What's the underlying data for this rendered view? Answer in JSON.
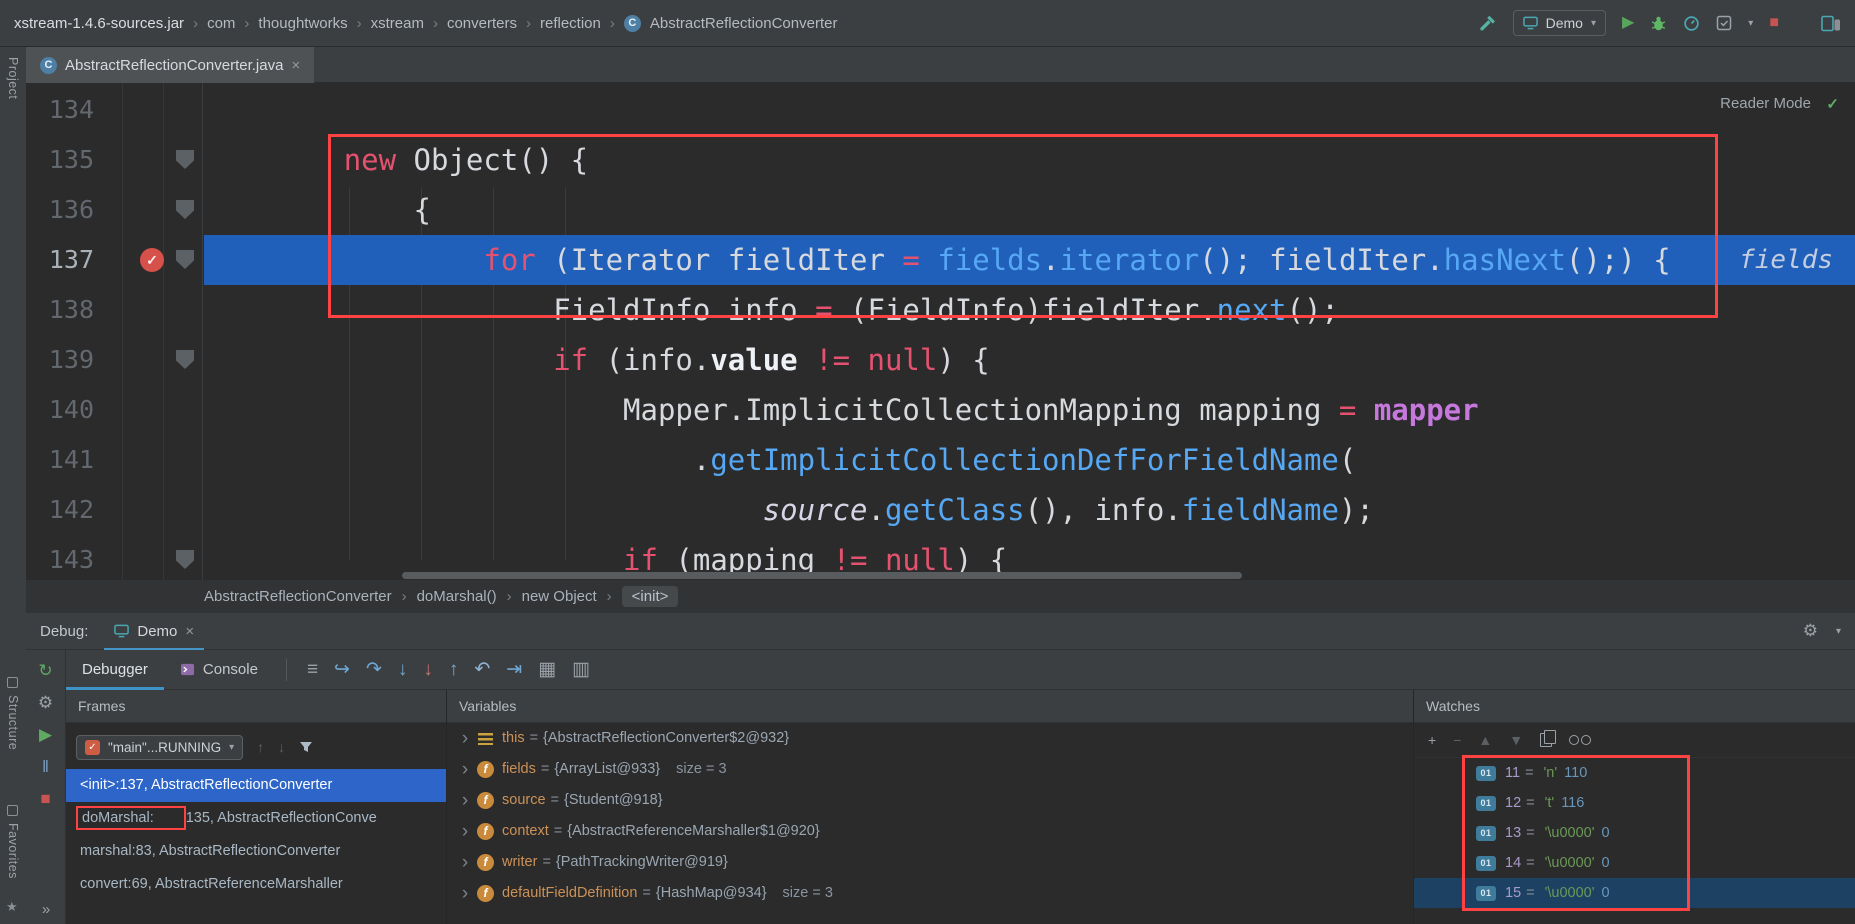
{
  "icons": {
    "class_glyph": "C",
    "check_glyph": "✓",
    "close_glyph": "×",
    "combo_arrow_glyph": "▾",
    "separator_glyph": "›",
    "primitive_glyph": "01",
    "field_glyph": "f",
    "gear_glyph": "⚙",
    "star_glyph": "★",
    "run_glyph": "▶",
    "stop_glyph": "■",
    "up_glyph": "↑",
    "down_glyph": "↓",
    "more_glyph": "»"
  },
  "topbar": {
    "path": [
      "xstream-1.4.6-sources.jar",
      "com",
      "thoughtworks",
      "xstream",
      "converters",
      "reflection"
    ],
    "class_name": "AbstractReflectionConverter",
    "run_config": "Demo"
  },
  "stripes": {
    "project": "Project",
    "structure": "Structure",
    "favorites": "Favorites"
  },
  "editor": {
    "tab": "AbstractReflectionConverter.java",
    "reader_mode": "Reader Mode",
    "inline_hint": "fields",
    "breadcrumbs": [
      "AbstractReflectionConverter",
      "doMarshal()",
      "new Object",
      "<init>"
    ],
    "lines": [
      {
        "num": "134",
        "gutter": "",
        "tokens": []
      },
      {
        "num": "135",
        "gutter": "pent",
        "tokens": [
          [
            "        ",
            "pl"
          ],
          [
            "new",
            "kw"
          ],
          [
            " Object() {",
            "pl"
          ]
        ]
      },
      {
        "num": "136",
        "gutter": "pent",
        "tokens": [
          [
            "            {",
            "pl"
          ]
        ]
      },
      {
        "num": "137",
        "gutter": "bp",
        "current": true,
        "tokens": [
          [
            "                ",
            "pl"
          ],
          [
            "for",
            "kw"
          ],
          [
            " (Iterator fieldIter ",
            "pl"
          ],
          [
            "=",
            "kw"
          ],
          [
            " ",
            "pl"
          ],
          [
            "fields",
            "fld"
          ],
          [
            ".",
            "pl"
          ],
          [
            "iterator",
            "mtd"
          ],
          [
            "(); fieldIter.",
            "pl"
          ],
          [
            "hasNext",
            "mtd"
          ],
          [
            "();) {",
            "pl"
          ]
        ]
      },
      {
        "num": "138",
        "gutter": "",
        "tokens": [
          [
            "                    FieldInfo info ",
            "pl"
          ],
          [
            "=",
            "kw"
          ],
          [
            " (FieldInfo)fieldIter.",
            "pl"
          ],
          [
            "next",
            "mtd"
          ],
          [
            "();",
            "pl"
          ]
        ]
      },
      {
        "num": "139",
        "gutter": "pent",
        "tokens": [
          [
            "                    ",
            "pl"
          ],
          [
            "if",
            "kw"
          ],
          [
            " (info.",
            "pl"
          ],
          [
            "value",
            "bold"
          ],
          [
            " ",
            "pl"
          ],
          [
            "!=",
            "kw"
          ],
          [
            " ",
            "pl"
          ],
          [
            "null",
            "kw"
          ],
          [
            ") {",
            "pl"
          ]
        ]
      },
      {
        "num": "140",
        "gutter": "",
        "tokens": [
          [
            "                        Mapper.ImplicitCollectionMapping mapping ",
            "pl"
          ],
          [
            "=",
            "kw"
          ],
          [
            " ",
            "pl"
          ],
          [
            "mapper",
            "fldp"
          ]
        ]
      },
      {
        "num": "141",
        "gutter": "",
        "tokens": [
          [
            "                            .",
            "pl"
          ],
          [
            "getImplicitCollectionDefForFieldName",
            "mtd"
          ],
          [
            "(",
            "pl"
          ]
        ]
      },
      {
        "num": "142",
        "gutter": "",
        "tokens": [
          [
            "                                ",
            "pl"
          ],
          [
            "source",
            "prm"
          ],
          [
            ".",
            "pl"
          ],
          [
            "getClass",
            "mtd"
          ],
          [
            "(), info.",
            "pl"
          ],
          [
            "fieldName",
            "fld"
          ],
          [
            ");",
            "pl"
          ]
        ]
      },
      {
        "num": "143",
        "gutter": "pent",
        "tokens": [
          [
            "                        ",
            "pl"
          ],
          [
            "if",
            "kw"
          ],
          [
            " (mapping ",
            "pl"
          ],
          [
            "!=",
            "kw"
          ],
          [
            " ",
            "pl"
          ],
          [
            "null",
            "kw"
          ],
          [
            ") {",
            "pl"
          ]
        ]
      }
    ]
  },
  "debug": {
    "label": "Debug:",
    "tab": "Demo",
    "tabs": [
      {
        "label": "Debugger"
      },
      {
        "label": "Console"
      }
    ],
    "toolbar_icons": [
      {
        "name": "layout-menu-icon",
        "glyph": "≡",
        "color": "#9aa1a8"
      },
      {
        "name": "show-execution-point-icon",
        "glyph": "↪",
        "color": "#6fa8d4"
      },
      {
        "name": "step-over-icon",
        "glyph": "↷",
        "color": "#6fa8d4"
      },
      {
        "name": "step-into-icon",
        "glyph": "↓",
        "color": "#6fa8d4"
      },
      {
        "name": "force-step-into-icon",
        "glyph": "↓",
        "color": "#c7756f"
      },
      {
        "name": "step-out-icon",
        "glyph": "↑",
        "color": "#6fa8d4"
      },
      {
        "name": "drop-frame-icon",
        "glyph": "↶",
        "color": "#8fb3d4"
      },
      {
        "name": "run-to-cursor-icon",
        "glyph": "⇥",
        "color": "#6fa8d4"
      },
      {
        "name": "evaluate-expression-icon",
        "glyph": "▦",
        "color": "#9aa1a8"
      },
      {
        "name": "layout-settings-icon",
        "glyph": "▥",
        "color": "#9aa1a8"
      }
    ],
    "rail_icons": [
      {
        "name": "rerun-icon",
        "glyph": "↻",
        "color": "#5fa962"
      },
      {
        "name": "settings-wrench-icon",
        "glyph": "⚙",
        "color": "#9aa1a7"
      },
      {
        "name": "resume-icon",
        "glyph": "▶",
        "color": "#5fa962"
      },
      {
        "name": "pause-icon",
        "glyph": "‖",
        "color": "#7a9cc0"
      },
      {
        "name": "stop-icon",
        "glyph": "■",
        "color": "#c75450"
      }
    ],
    "frames": {
      "title": "Frames",
      "thread": "\"main\"...RUNNING",
      "rows": [
        {
          "text": "<init>:137, AbstractReflectionConverter",
          "selected": true
        },
        {
          "prefix": "doMarshal:",
          "text": "135, AbstractReflectionConve",
          "boxed": true
        },
        {
          "text": "marshal:83, AbstractReflectionConverter"
        },
        {
          "text": "convert:69, AbstractReferenceMarshaller"
        }
      ]
    },
    "variables": {
      "title": "Variables",
      "rows": [
        {
          "name": "this",
          "icon": "this",
          "value": "{AbstractReflectionConverter$2@932}",
          "extra": ""
        },
        {
          "name": "fields",
          "icon": "f",
          "value": "{ArrayList@933}",
          "extra": "size = 3"
        },
        {
          "name": "source",
          "icon": "f",
          "value": "{Student@918}",
          "extra": ""
        },
        {
          "name": "context",
          "icon": "f",
          "value": "{AbstractReferenceMarshaller$1@920}",
          "extra": ""
        },
        {
          "name": "writer",
          "icon": "f",
          "value": "{PathTrackingWriter@919}",
          "extra": ""
        },
        {
          "name": "defaultFieldDefinition",
          "icon": "f",
          "value": "{HashMap@934}",
          "extra": "size = 3"
        }
      ]
    },
    "watches": {
      "title": "Watches",
      "toolbar": [
        {
          "name": "add-watch-icon",
          "glyph": "+"
        },
        {
          "name": "remove-watch-icon",
          "glyph": "−",
          "dim": true
        },
        {
          "name": "move-watch-up-icon",
          "glyph": "▲",
          "dim": true
        },
        {
          "name": "move-watch-down-icon",
          "glyph": "▼",
          "dim": true
        },
        {
          "name": "copy-icon",
          "css": "copyicon"
        },
        {
          "name": "show-watches-icon",
          "css": "glasses"
        }
      ],
      "rows": [
        {
          "index": "11",
          "char": "'n'",
          "num": "110"
        },
        {
          "index": "12",
          "char": "'t'",
          "num": "116"
        },
        {
          "index": "13",
          "char": "'\\u0000'",
          "num": "0"
        },
        {
          "index": "14",
          "char": "'\\u0000'",
          "num": "0"
        },
        {
          "index": "15",
          "char": "'\\u0000'",
          "num": "0",
          "selected": true
        }
      ]
    }
  }
}
